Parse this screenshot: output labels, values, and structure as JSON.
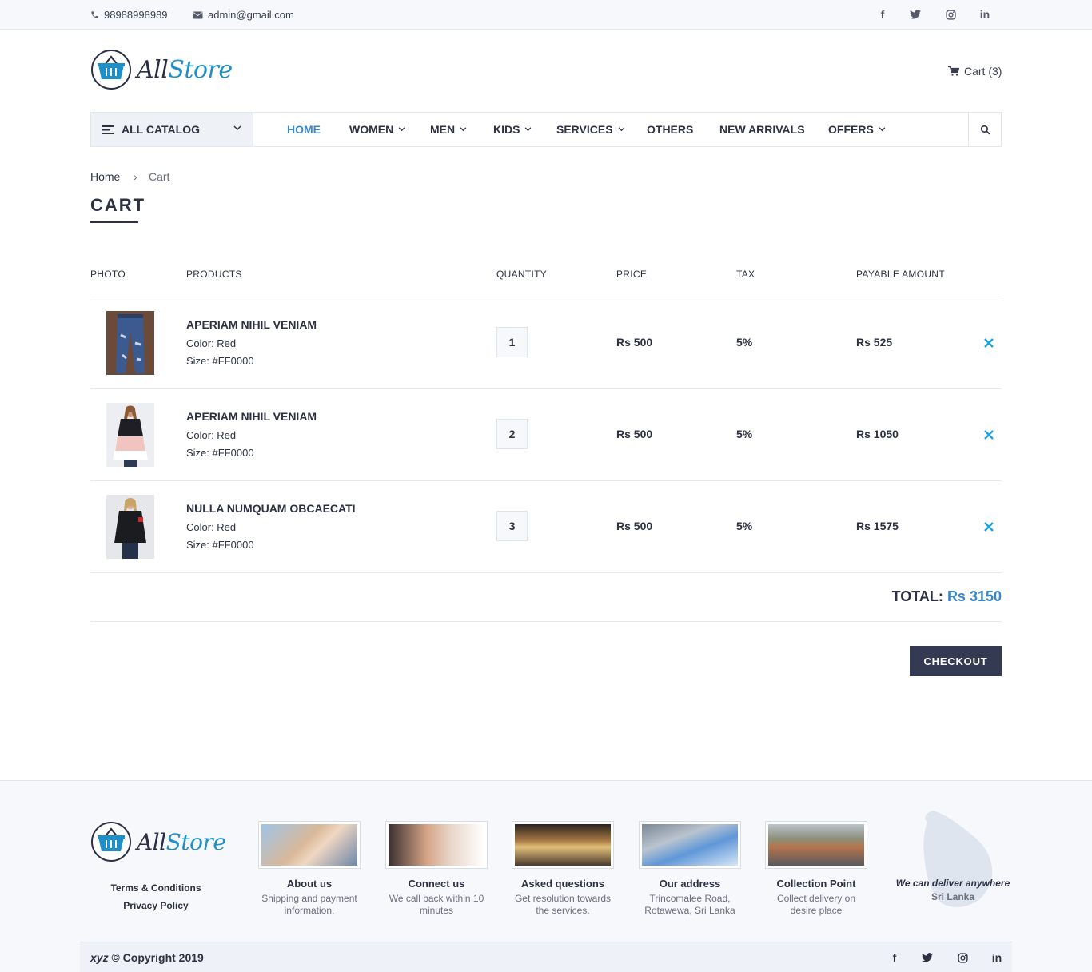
{
  "topbar": {
    "phone": "98988998989",
    "email": "admin@gmail.com",
    "social": [
      "facebook-icon",
      "twitter-icon",
      "instagram-icon",
      "linkedin-icon"
    ]
  },
  "header": {
    "logo_part1": "All",
    "logo_part2": "Store",
    "cart_label": "Cart (3)"
  },
  "nav": {
    "catalog_label": "ALL CATALOG",
    "items": [
      {
        "label": "HOME"
      },
      {
        "label": "WOMEN"
      },
      {
        "label": "MEN"
      },
      {
        "label": "KIDS"
      },
      {
        "label": "SERVICES"
      },
      {
        "label": "OTHERS"
      },
      {
        "label": "NEW ARRIVALS"
      },
      {
        "label": "OFFERS"
      }
    ]
  },
  "breadcrumb": {
    "home": "Home",
    "separator": "›",
    "current": "Cart"
  },
  "page_title": "CART",
  "table": {
    "headers": [
      "PHOTO",
      "PRODUCTS",
      "QUANTITY",
      "PRICE",
      "TAX",
      "PAYABLE AMOUNT"
    ],
    "rows": [
      {
        "name": "APERIAM NIHIL VENIAM",
        "color": "Color: Red",
        "size": "Size: #FF0000",
        "quantity": "1",
        "price": "Rs 500",
        "tax": "5%",
        "payable": "Rs 525",
        "image": "jeans"
      },
      {
        "name": "APERIAM NIHIL VENIAM",
        "color": "Color: Red",
        "size": "Size: #FF0000",
        "quantity": "2",
        "price": "Rs 500",
        "tax": "5%",
        "payable": "Rs 1050",
        "image": "blouse"
      },
      {
        "name": "NULLA NUMQUAM OBCAECATI",
        "color": "Color: Red",
        "size": "Size: #FF0000",
        "quantity": "3",
        "price": "Rs 500",
        "tax": "5%",
        "payable": "Rs 1575",
        "image": "black-top"
      }
    ]
  },
  "total": {
    "label": "TOTAL:",
    "amount": "Rs 3150"
  },
  "checkout_label": "CHECKOUT",
  "footer": {
    "links": [
      "Terms & Conditions",
      "Privacy Policy"
    ],
    "features": [
      {
        "title": "About us",
        "desc": "Shipping and payment information."
      },
      {
        "title": "Connect us",
        "desc": "We call back within 10 minutes"
      },
      {
        "title": "Asked questions",
        "desc": "Get resolution towards the services."
      },
      {
        "title": "Our address",
        "desc": "Trincomalee Road, Rotawewa, Sri Lanka"
      },
      {
        "title": "Collection Point",
        "desc": "Collect delivery on desire place"
      }
    ],
    "deliver_line1": "We can deliver anywhere",
    "deliver_line2": "Sri Lanka",
    "copyright_brand": "xyz",
    "copyright_text": " © Copyright 2019"
  },
  "colors": {
    "accent": "#3a86c6",
    "dark": "#343a52",
    "remove": "#1fa1d8"
  }
}
